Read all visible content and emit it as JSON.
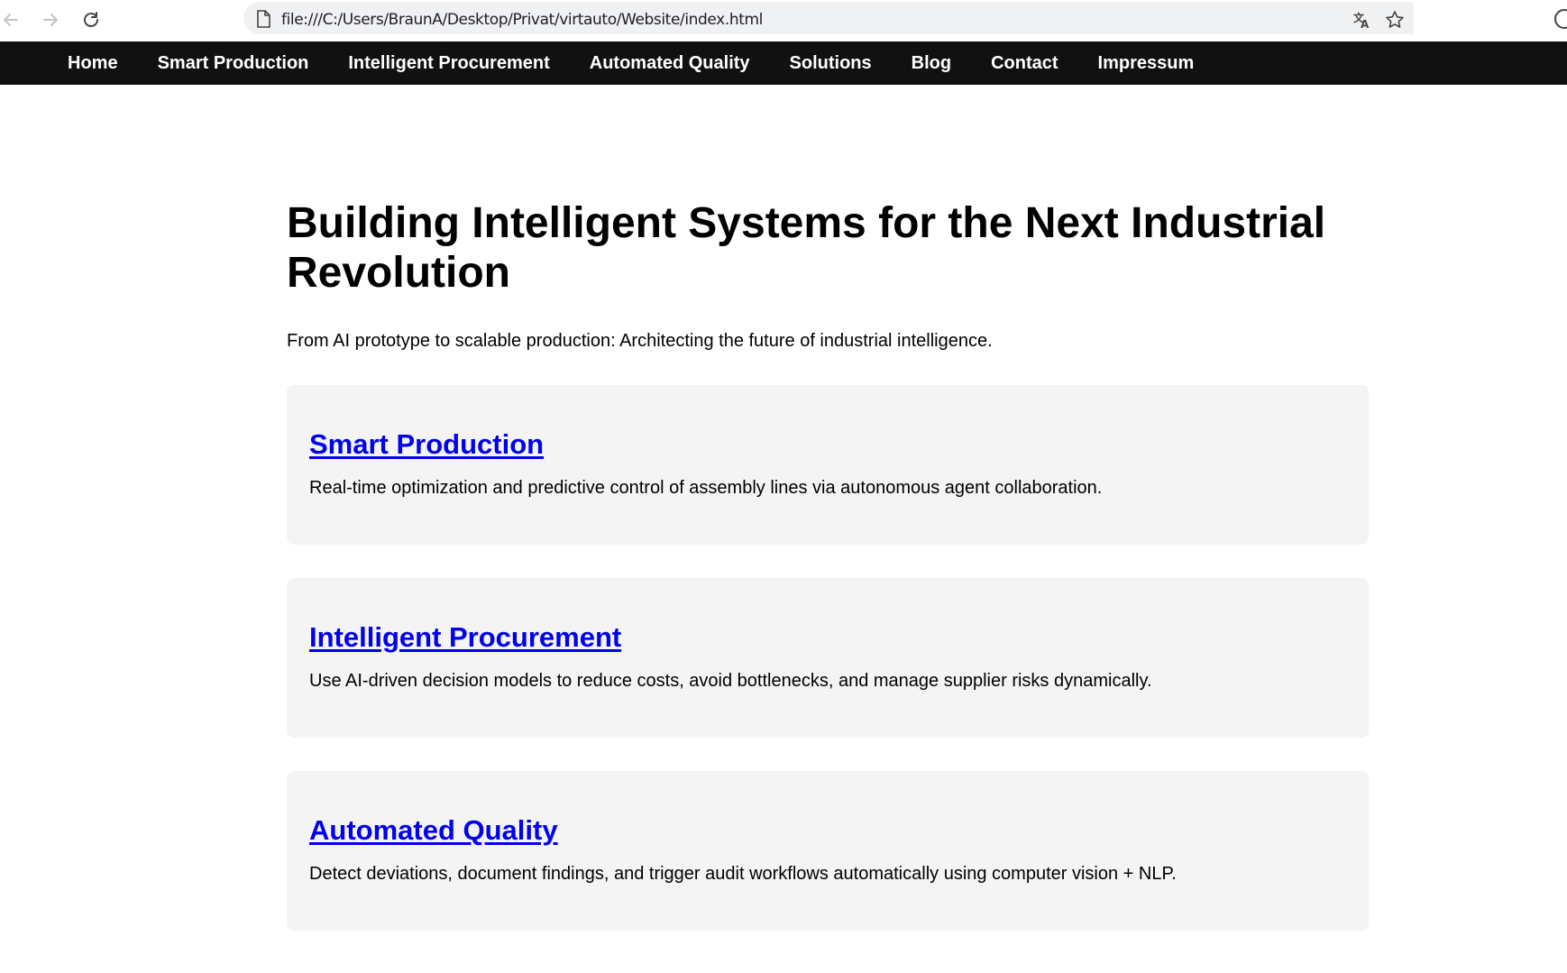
{
  "browser": {
    "url": "file:///C:/Users/BraunA/Desktop/Privat/virtauto/Website/index.html",
    "icons": [
      "back-icon",
      "forward-icon",
      "reload-icon",
      "page-icon",
      "translate-icon",
      "star-icon",
      "profile-icon"
    ]
  },
  "nav": {
    "items": [
      {
        "label": "Home"
      },
      {
        "label": "Smart Production"
      },
      {
        "label": "Intelligent Procurement"
      },
      {
        "label": "Automated Quality"
      },
      {
        "label": "Solutions"
      },
      {
        "label": "Blog"
      },
      {
        "label": "Contact"
      },
      {
        "label": "Impressum"
      }
    ]
  },
  "hero": {
    "title": "Building Intelligent Systems for the Next Industrial Revolution",
    "tagline": "From AI prototype to scalable production: Architecting the future of industrial intelligence."
  },
  "cards": [
    {
      "title": "Smart Production",
      "description": "Real-time optimization and predictive control of assembly lines via autonomous agent collaboration."
    },
    {
      "title": "Intelligent Procurement",
      "description": "Use AI-driven decision models to reduce costs, avoid bottlenecks, and manage supplier risks dynamically."
    },
    {
      "title": "Automated Quality",
      "description": "Detect deviations, document findings, and trigger audit workflows automatically using computer vision + NLP."
    }
  ],
  "colors": {
    "nav_bg": "#111111",
    "link": "#0000ee",
    "card_bg": "#f4f4f4"
  }
}
